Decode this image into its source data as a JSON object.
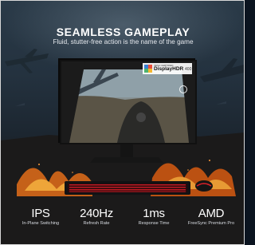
{
  "headline": {
    "title": "SEAMLESS GAMEPLAY",
    "subtitle": "Fluid, stutter-free action is the name of the game"
  },
  "hdr_badge": {
    "small_text": "VESA CERTIFIED",
    "text": "DisplayHDR",
    "number": "400"
  },
  "specs": [
    {
      "value": "IPS",
      "label": "In-Plane Switching"
    },
    {
      "value": "240Hz",
      "label": "Refresh Rate"
    },
    {
      "value": "1ms",
      "label": "Response Time"
    },
    {
      "value": "AMD",
      "label": "FreeSync Premium Pro"
    }
  ],
  "colors": {
    "fire": "#ff6a14",
    "keyboard_accent": "#e0202a",
    "text": "#ffffff"
  },
  "icons": [
    "vesa-displayhdr-logo-icon",
    "ring-icon"
  ]
}
